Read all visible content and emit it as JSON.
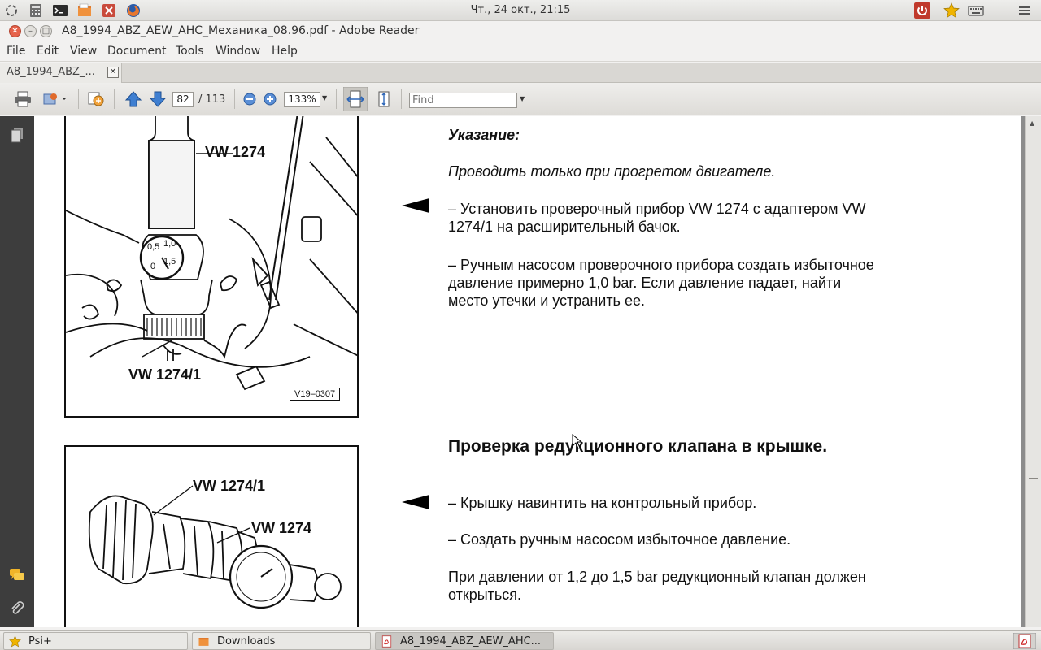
{
  "top_panel": {
    "clock": "Чт., 24 окт., 21:15",
    "left_icons": [
      "launcher-icon",
      "calculator-icon",
      "terminal-icon",
      "files-icon",
      "settings-icon",
      "firefox-icon"
    ],
    "right_icons": [
      "power-icon",
      "star-icon",
      "keyboard-icon",
      "menu-icon"
    ]
  },
  "window": {
    "title": "A8_1994_ABZ_AEW_AHC_Механика_08.96.pdf - Adobe Reader"
  },
  "menubar": {
    "items": [
      "File",
      "Edit",
      "View",
      "Document",
      "Tools",
      "Window",
      "Help"
    ]
  },
  "tab": {
    "label": "A8_1994_ABZ_...",
    "close": "✕"
  },
  "toolbar": {
    "page_current": "82",
    "page_total": "/ 113",
    "zoom": "133%",
    "find_placeholder": "Find"
  },
  "document": {
    "fig1": {
      "label_top": "VW 1274",
      "label_bottom": "VW 1274/1",
      "code": "V19–0307",
      "gauge_marks": [
        "0,5",
        "1,0",
        "1,5",
        "0"
      ]
    },
    "fig2": {
      "label_a": "VW 1274/1",
      "label_b": "VW 1274"
    },
    "note_heading": "Указание:",
    "note_text": "Проводить только при прогретом двигателе.",
    "step1_line1": "– Установить проверочный прибор VW 1274 с адаптером VW",
    "step1_line2": "1274/1 на расширительный бачок.",
    "step2_line1": "– Ручным насосом проверочного прибора создать избыточное",
    "step2_line2": "давление примерно 1,0 bar. Если давление падает, найти",
    "step2_line3": "место утечки и устранить ее.",
    "section_heading": "Проверка редукционного клапана в крышке.",
    "step3": "– Крышку навинтить на контрольный прибор.",
    "step4": "– Создать ручным насосом избыточное давление.",
    "result_line1": "При давлении от 1,2 до 1,5 bar редукционный клапан должен",
    "result_line2": "открыться."
  },
  "taskbar": {
    "items": [
      {
        "label": "Psi+",
        "icon": "star-icon"
      },
      {
        "label": "Downloads",
        "icon": "folder-icon"
      },
      {
        "label": "A8_1994_ABZ_AEW_AHC...",
        "icon": "pdf-icon"
      }
    ]
  }
}
